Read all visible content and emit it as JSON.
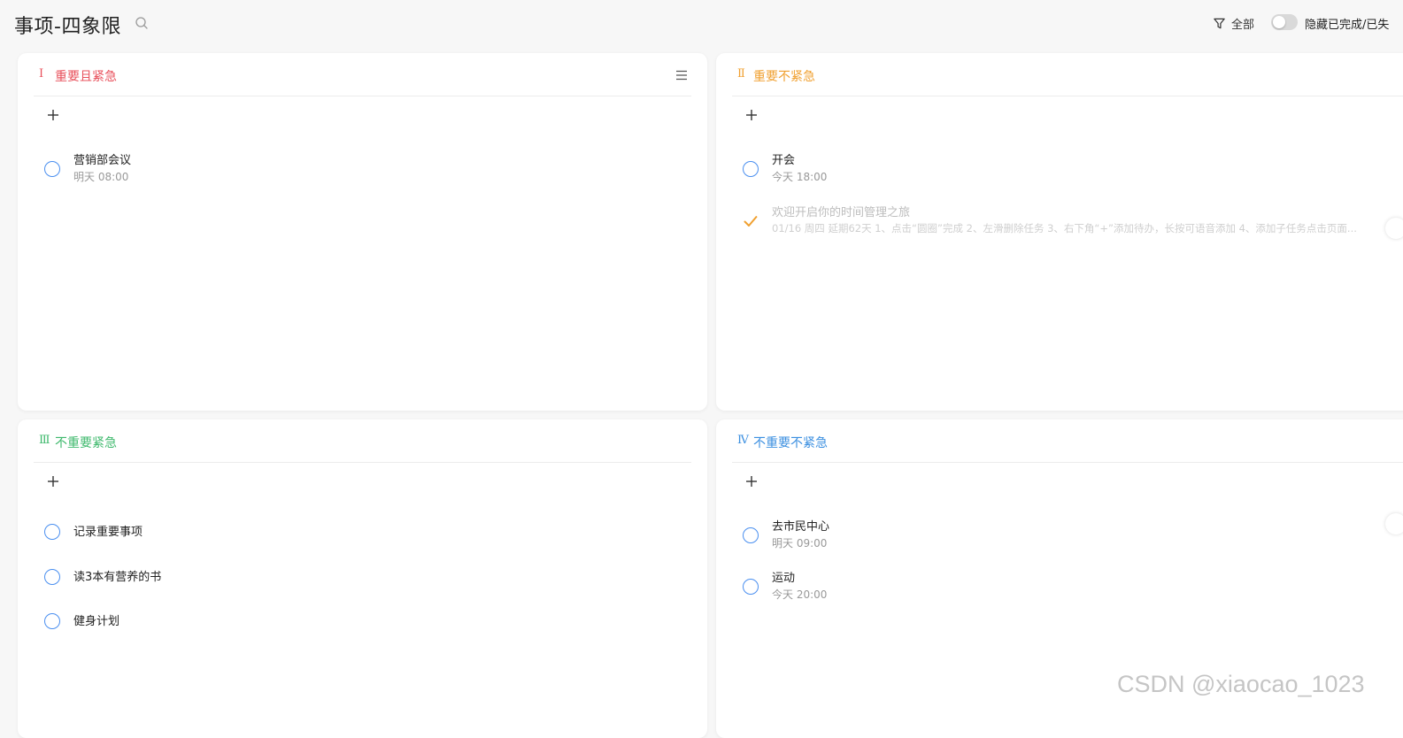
{
  "header": {
    "title": "事项-四象限",
    "filter_label": "全部",
    "hide_completed_label": "隐藏已完成/已失",
    "hide_completed_on": false
  },
  "colors": {
    "q1": "#e8505b",
    "q2": "#f0a030",
    "q3": "#3fb96d",
    "q4": "#3b8fe0",
    "check_ring": "#4a8ff0",
    "done_check": "#f0a030"
  },
  "quadrants": [
    {
      "numeral": "Ⅰ",
      "title": "重要且紧急",
      "tasks": [
        {
          "name": "营销部会议",
          "sub": "明天 08:00",
          "done": false
        }
      ]
    },
    {
      "numeral": "Ⅱ",
      "title": "重要不紧急",
      "tasks": [
        {
          "name": "开会",
          "sub": "今天 18:00",
          "done": false
        },
        {
          "name": "欢迎开启你的时间管理之旅",
          "sub": "01/16 周四 延期62天 1、点击“圆圈”完成 2、左滑删除任务 3、右下角“+”添加待办，长按可语音添加 4、添加子任务点击页面...",
          "done": true
        }
      ]
    },
    {
      "numeral": "Ⅲ",
      "title": "不重要紧急",
      "tasks": [
        {
          "name": "记录重要事项",
          "done": false
        },
        {
          "name": "读3本有营养的书",
          "done": false
        },
        {
          "name": "健身计划",
          "done": false
        }
      ]
    },
    {
      "numeral": "Ⅳ",
      "title": "不重要不紧急",
      "tasks": [
        {
          "name": "去市民中心",
          "sub": "明天 09:00",
          "done": false
        },
        {
          "name": "运动",
          "sub": "今天 20:00",
          "done": false
        }
      ]
    }
  ],
  "icons": {
    "search": "search-icon",
    "filter": "filter-icon",
    "menu": "menu-icon",
    "add": "plus-icon",
    "done": "check-icon"
  },
  "watermark": "CSDN @xiaocao_1023"
}
